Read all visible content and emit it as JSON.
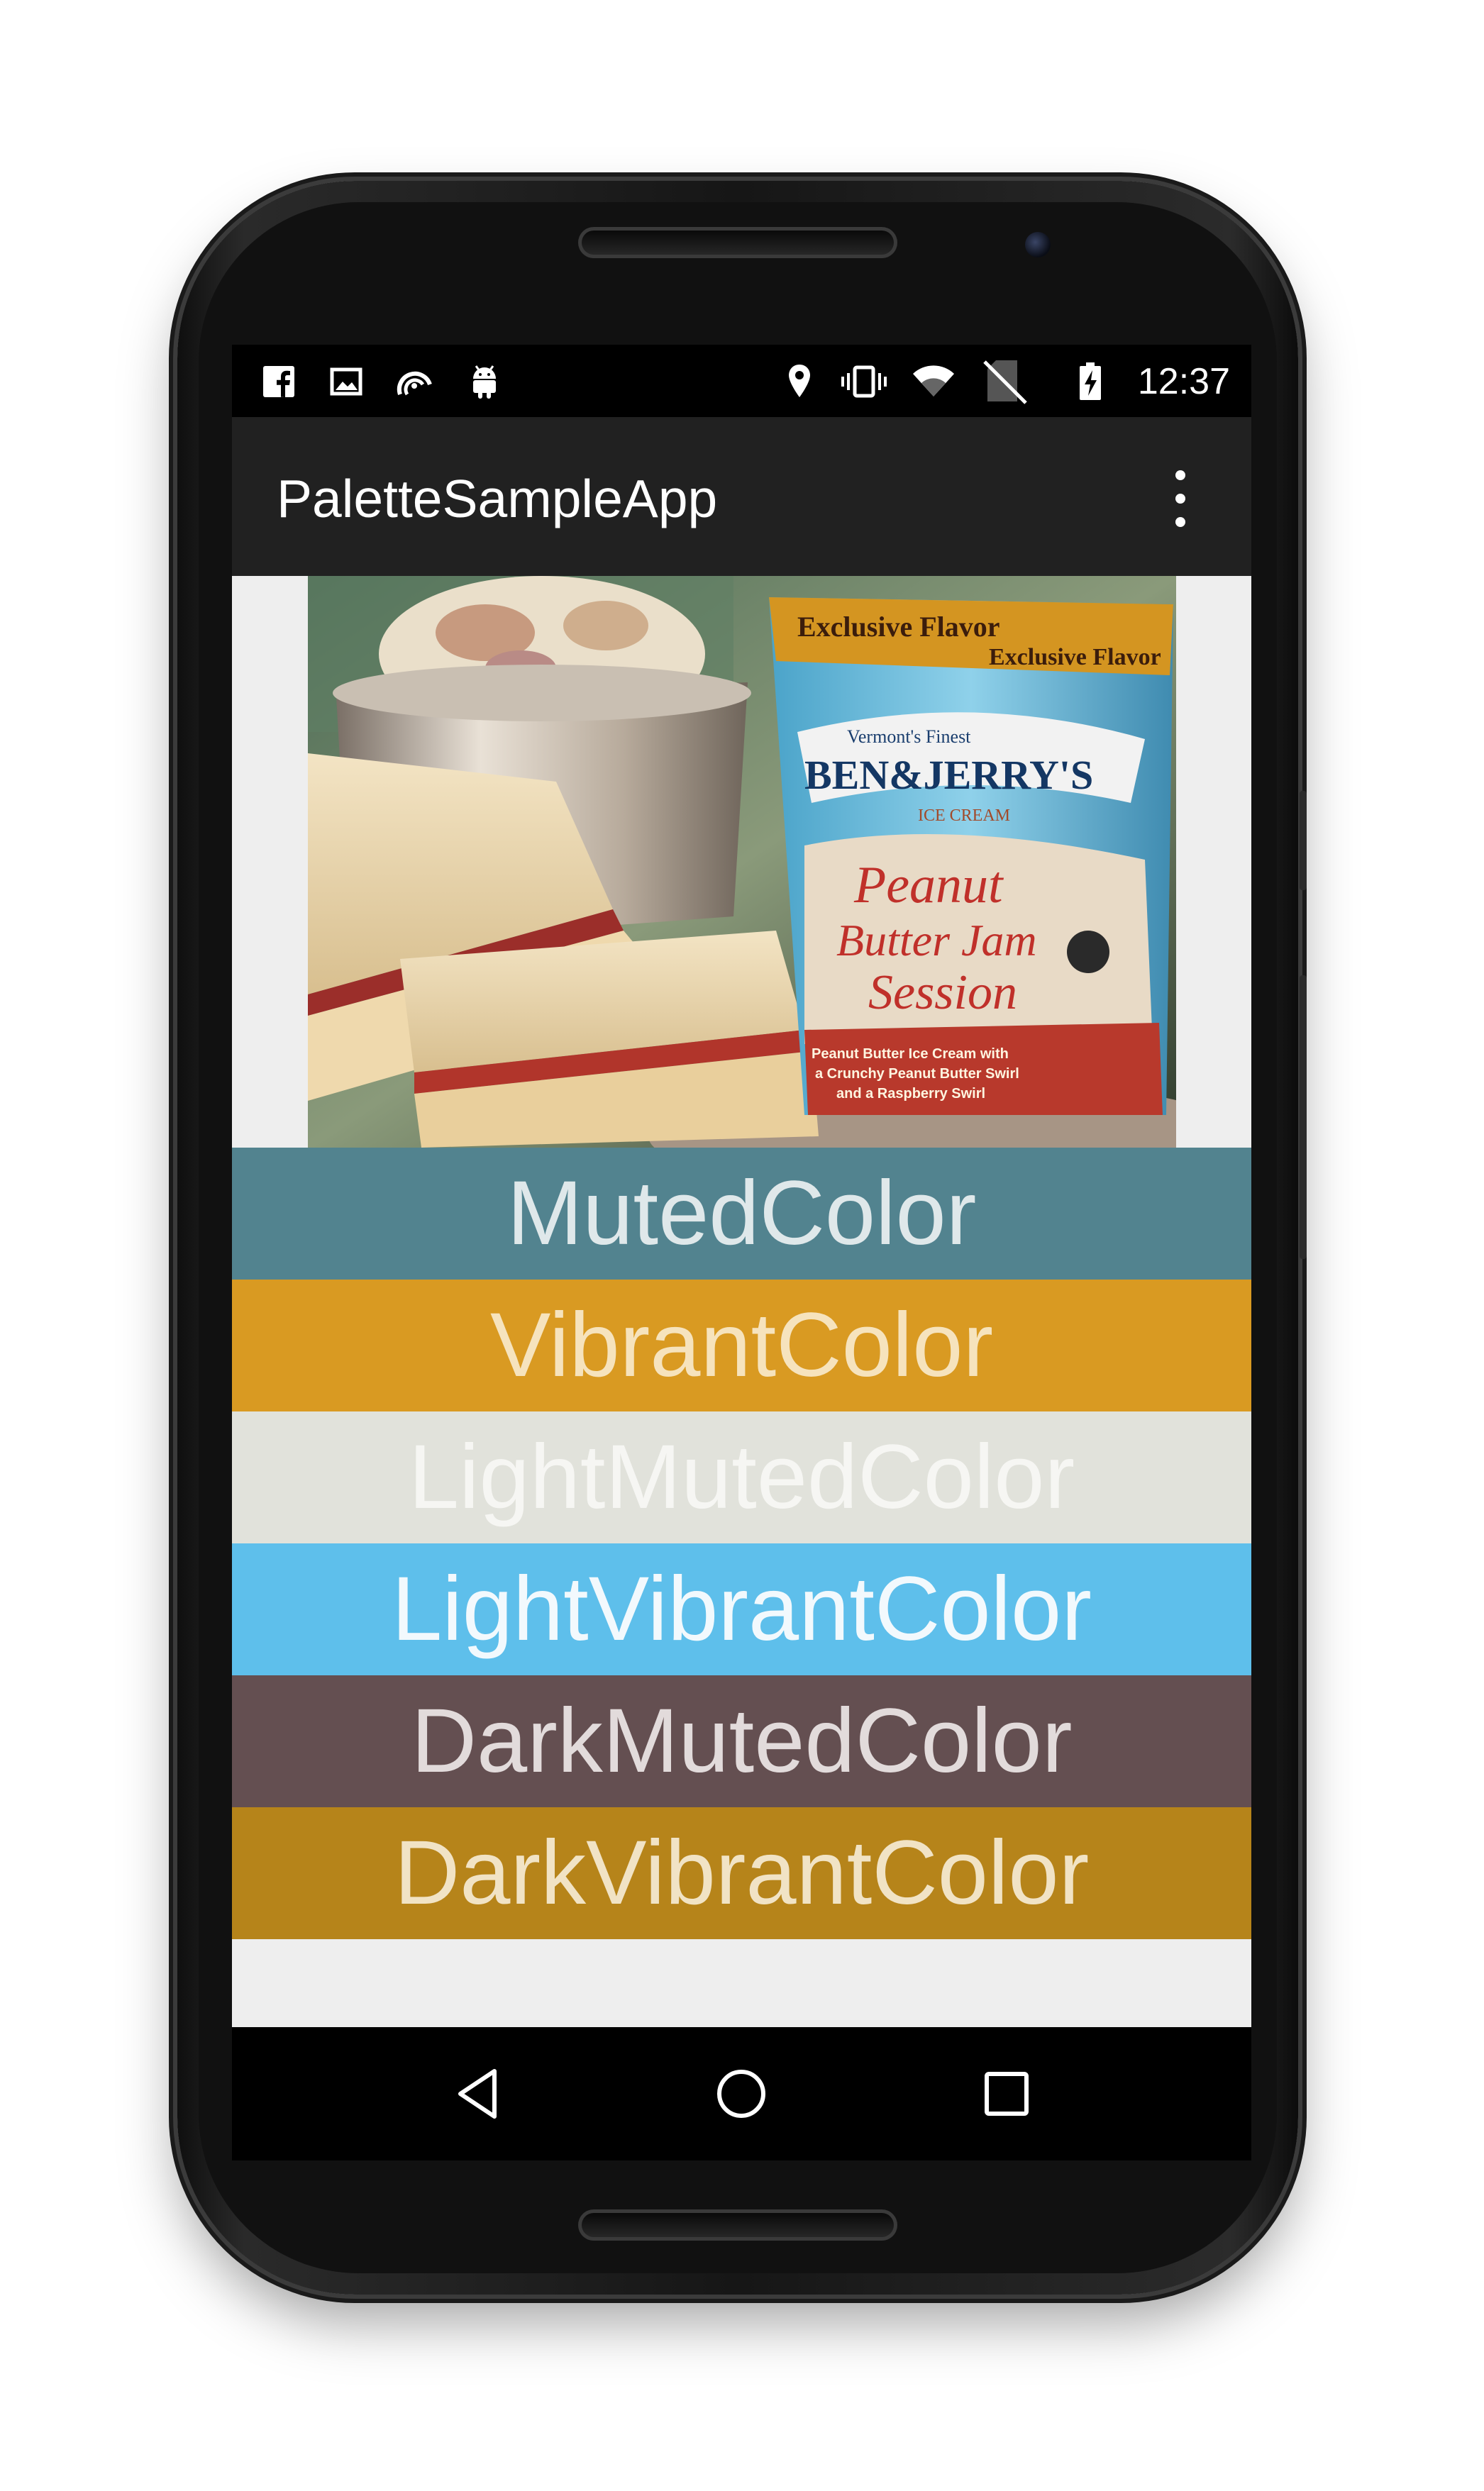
{
  "status_bar": {
    "time": "12:37",
    "left_icons": [
      "facebook-icon",
      "image-icon",
      "sync-icon",
      "android-icon"
    ],
    "right_icons": [
      "location-icon",
      "vibrate-icon",
      "wifi-icon",
      "no-sim-icon",
      "battery-charging-icon"
    ]
  },
  "app_bar": {
    "title": "PaletteSampleApp",
    "menu_icon": "more-vert-icon"
  },
  "image": {
    "pint_banner_1": "Exclusive Flavor",
    "pint_banner_2": "Exclusive Flavor",
    "pint_tagline": "Vermont's Finest",
    "pint_brand": "BEN&JERRY'S",
    "pint_subbrand": "ICE CREAM",
    "pint_flavor_1": "Peanut",
    "pint_flavor_2": "Butter Jam",
    "pint_flavor_3": "Session",
    "pint_desc_1": "Peanut Butter Ice Cream with",
    "pint_desc_2": "a Crunchy Peanut Butter Swirl",
    "pint_desc_3": "and a Raspberry Swirl"
  },
  "swatches": [
    {
      "label": "MutedColor",
      "bg": "#52838f",
      "fg": "#dfe8ea"
    },
    {
      "label": "VibrantColor",
      "bg": "#d99a22",
      "fg": "#f6e3bd"
    },
    {
      "label": "LightMutedColor",
      "bg": "#e1e2db",
      "fg": "#f6f6f3"
    },
    {
      "label": "LightVibrantColor",
      "bg": "#5ebfeb",
      "fg": "#f2f9fd"
    },
    {
      "label": "DarkMutedColor",
      "bg": "#644f51",
      "fg": "#e2dbdb"
    },
    {
      "label": "DarkVibrantColor",
      "bg": "#b6841a",
      "fg": "#f1e3c5"
    }
  ],
  "nav_bar": {
    "back_icon": "back-triangle-icon",
    "home_icon": "home-circle-icon",
    "recents_icon": "recents-square-icon"
  }
}
